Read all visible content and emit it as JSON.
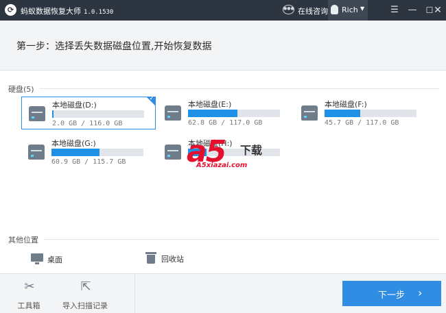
{
  "titlebar": {
    "title": "蚂蚁数据恢复大师",
    "version": "1.0.1530",
    "consult": "在线咨询",
    "username": "Rich",
    "chat_icon_text": "●●●"
  },
  "step": {
    "title": "第一步：选择丢失数据磁盘位置,开始恢复数据"
  },
  "disks_section": {
    "label": "硬盘(5)"
  },
  "disks": [
    {
      "name": "本地磁盘(D:)",
      "size": "2.0 GB / 116.0 GB",
      "used_fraction": 0.017,
      "selected": true
    },
    {
      "name": "本地磁盘(E:)",
      "size": "62.8 GB / 117.0 GB",
      "used_fraction": 0.537,
      "selected": false
    },
    {
      "name": "本地磁盘(F:)",
      "size": "45.7 GB / 117.0 GB",
      "used_fraction": 0.391,
      "selected": false
    },
    {
      "name": "本地磁盘(G:)",
      "size": "60.9 GB / 115.7 GB",
      "used_fraction": 0.526,
      "selected": false
    },
    {
      "name": "本地磁盘(H:)",
      "size": "",
      "used_fraction": 0.2,
      "selected": false
    }
  ],
  "other_section": {
    "label": "其他位置",
    "items": [
      {
        "name": "桌面",
        "icon": "monitor-icon"
      },
      {
        "name": "回收站",
        "icon": "recycle-bin-icon"
      }
    ]
  },
  "footer": {
    "toolbox": "工具箱",
    "import_scan": "导入扫描记录",
    "next": "下一步"
  },
  "watermark": {
    "logo": "a5",
    "cn": "下载",
    "domain": "A5xiazai.com"
  },
  "colors": {
    "accent": "#2f8de4",
    "titlebar": "#2d3540",
    "watermark": "#e3102e"
  }
}
